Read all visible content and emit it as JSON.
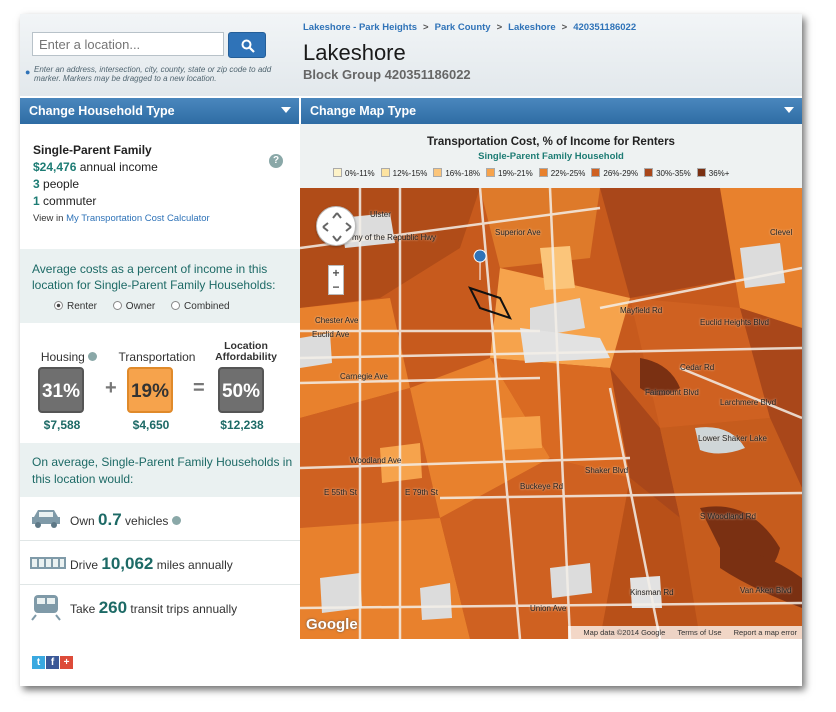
{
  "search": {
    "placeholder": "Enter a location...",
    "help": "Enter an address, intersection, city, county, state or zip code to add marker. Markers may be dragged to a new location."
  },
  "breadcrumb": [
    "Lakeshore - Park Heights",
    "Park County",
    "Lakeshore",
    "420351186022"
  ],
  "title": "Lakeshore",
  "subtitle": "Block Group 420351186022",
  "panels": {
    "household_label": "Change Household Type",
    "map_label": "Change Map Type"
  },
  "household": {
    "type": "Single-Parent Family",
    "income_value": "$24,476",
    "income_label": "annual income",
    "people_value": "3",
    "people_label": "people",
    "commuter_value": "1",
    "commuter_label": "commuter",
    "view_prefix": "View in",
    "calculator_link": "My Transportation Cost Calculator"
  },
  "averages": {
    "intro": "Average costs as a percent of income in this location for Single-Parent Family Households:",
    "options": [
      "Renter",
      "Owner",
      "Combined"
    ],
    "selected": "Renter"
  },
  "costs": {
    "housing_label": "Housing",
    "transport_label": "Transportation",
    "afford_label_1": "Location",
    "afford_label_2": "Affordability",
    "housing_pct": "31%",
    "transport_pct": "19%",
    "afford_pct": "50%",
    "housing_amt": "$7,588",
    "transport_amt": "$4,650",
    "afford_amt": "$12,238",
    "plus": "+",
    "equals": "="
  },
  "onaverage": "On average, Single-Parent Family Households in this location would:",
  "stats": {
    "own_pre": "Own",
    "own_val": "0.7",
    "own_post": "vehicles",
    "drive_pre": "Drive",
    "drive_val": "10,062",
    "drive_post": "miles annually",
    "take_pre": "Take",
    "take_val": "260",
    "take_post": "transit trips annually"
  },
  "map": {
    "title": "Transportation Cost, % of Income for Renters",
    "subtitle": "Single-Parent Family Household",
    "legend": [
      {
        "label": "0%-11%",
        "color": "#fdf3c8"
      },
      {
        "label": "12%-15%",
        "color": "#fde3a0"
      },
      {
        "label": "16%-18%",
        "color": "#fbc57a"
      },
      {
        "label": "19%-21%",
        "color": "#f6a34c"
      },
      {
        "label": "22%-25%",
        "color": "#e8812d"
      },
      {
        "label": "26%-29%",
        "color": "#cf6121"
      },
      {
        "label": "30%-35%",
        "color": "#a9471a"
      },
      {
        "label": "36%+",
        "color": "#7a3012"
      }
    ],
    "streets": [
      "Chester Ave",
      "Euclid Ave",
      "Carnegie Ave",
      "Woodland Ave",
      "Buckeye Rd",
      "Mayfield Rd",
      "Euclid Heights Blvd",
      "Cedar Rd",
      "Fairmount Blvd",
      "Shaker Blvd",
      "Union Ave",
      "Kinsman Rd",
      "Grand Army of the Republic Hwy",
      "Van Aken Blvd",
      "Lower Shaker Lake",
      "S Woodland Rd",
      "E 55th St",
      "E 79th St",
      "Ulster",
      "Clevel",
      "Superior Ave",
      "Larchmere Blvd"
    ],
    "zoom_in": "+",
    "zoom_out": "−",
    "google": "Google",
    "attribution": [
      "Map data ©2014 Google",
      "Terms of Use",
      "Report a map error"
    ]
  },
  "social": [
    "t",
    "f",
    "+"
  ]
}
